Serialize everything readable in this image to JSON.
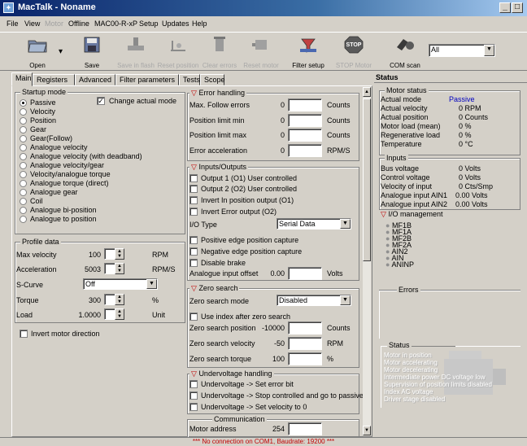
{
  "window": {
    "title": "MacTalk - Noname",
    "minimize": "_",
    "maximize": "□"
  },
  "menu": [
    {
      "label": "File",
      "enabled": true
    },
    {
      "label": "View",
      "enabled": true
    },
    {
      "label": "Motor",
      "enabled": false
    },
    {
      "label": "Offline",
      "enabled": true
    },
    {
      "label": "MAC00-R-xP",
      "enabled": true
    },
    {
      "label": "Setup",
      "enabled": true
    },
    {
      "label": "Updates",
      "enabled": true
    },
    {
      "label": "Help",
      "enabled": true
    }
  ],
  "toolbar": {
    "open": "Open",
    "save": "Save",
    "save_flash": "Save in flash",
    "reset_position": "Reset position",
    "clear_errors": "Clear errors",
    "reset_motor": "Reset motor",
    "filter_setup": "Filter setup",
    "stop_motor": "STOP Motor",
    "stop_sign": "STOP",
    "com_scan": "COM scan",
    "port_value": "All"
  },
  "tabs": [
    "Main",
    "Registers",
    "Advanced",
    "Filter parameters",
    "Tests",
    "Scope"
  ],
  "startup_mode": {
    "title": "Startup mode",
    "change_actual_mode": "Change actual mode",
    "options": [
      "Passive",
      "Velocity",
      "Position",
      "Gear",
      "Gear(Follow)",
      "Analogue velocity",
      "Analogue velocity (with deadband)",
      "Analogue velocity/gear",
      "Velocity/analogue torque",
      "Analogue torque (direct)",
      "Analogue gear",
      "Coil",
      "Analogue bi-position",
      "Analogue to position"
    ],
    "selected": "Passive"
  },
  "profile_data": {
    "title": "Profile data",
    "rows": [
      {
        "label": "Max velocity",
        "value": "100",
        "unit": "RPM"
      },
      {
        "label": "Acceleration",
        "value": "5003",
        "unit": "RPM/S"
      },
      {
        "label": "S-Curve",
        "value": "Off",
        "unit": ""
      },
      {
        "label": "Torque",
        "value": "300",
        "unit": "%"
      },
      {
        "label": "Load",
        "value": "1.0000",
        "unit": "Unit"
      }
    ],
    "invert_direction": "Invert motor direction"
  },
  "error_handling": {
    "title": "Error handling",
    "rows": [
      {
        "label": "Max. Follow errors",
        "value": "0",
        "unit": "Counts"
      },
      {
        "label": "Position limit min",
        "value": "0",
        "unit": "Counts"
      },
      {
        "label": "Position limit max",
        "value": "0",
        "unit": "Counts"
      },
      {
        "label": "Error acceleration",
        "value": "0",
        "unit": "RPM/S"
      }
    ]
  },
  "inputs_outputs": {
    "title": "Inputs/Outputs",
    "checks": [
      "Output 1 (O1) User controlled",
      "Output 2 (O2) User controlled",
      "Invert In position output (O1)",
      "Invert Error output (O2)"
    ],
    "io_type_label": "I/O Type",
    "io_type_value": "Serial Data",
    "checks2": [
      "Positive edge position capture",
      "Negative edge position capture",
      "Disable brake"
    ],
    "analogue_offset_label": "Analogue input offset",
    "analogue_offset_value": "0.00",
    "analogue_offset_unit": "Volts"
  },
  "zero_search": {
    "title": "Zero search",
    "mode_label": "Zero search mode",
    "mode_value": "Disabled",
    "use_index": "Use index after zero search",
    "rows": [
      {
        "label": "Zero search position",
        "value": "-10000",
        "unit": "Counts"
      },
      {
        "label": "Zero search velocity",
        "value": "-50",
        "unit": "RPM"
      },
      {
        "label": "Zero search torque",
        "value": "100",
        "unit": "%"
      }
    ]
  },
  "undervoltage": {
    "title": "Undervoltage handling",
    "checks": [
      "Undervoltage -> Set error bit",
      "Undervoltage -> Stop controlled and go to passive",
      "Undervoltage -> Set velocity to 0"
    ]
  },
  "communication": {
    "title": "Communication",
    "motor_address_label": "Motor address",
    "motor_address_value": "254"
  },
  "status": {
    "title": "Status",
    "motor_status_title": "Motor status",
    "motor_rows": [
      {
        "label": "Actual mode",
        "value": "Passive"
      },
      {
        "label": "Actual velocity",
        "value": "0 RPM"
      },
      {
        "label": "Actual position",
        "value": "0 Counts"
      },
      {
        "label": "Motor load (mean)",
        "value": "0 %"
      },
      {
        "label": "Regenerative load",
        "value": "0 %"
      },
      {
        "label": "Temperature",
        "value": "0 °C"
      }
    ],
    "inputs_title": "Inputs",
    "input_rows": [
      {
        "label": "Bus voltage",
        "value": "0 Volts"
      },
      {
        "label": "Control voltage",
        "value": "0 Volts"
      },
      {
        "label": "Velocity of input",
        "value": "0 Cts/Smp"
      },
      {
        "label": "Analogue input AIN1",
        "value": "0.00 Volts"
      },
      {
        "label": "Analogue input AIN2",
        "value": "0.00 Volts"
      }
    ],
    "io_management_title": "I/O management",
    "io_items": [
      "MF1B",
      "MF1A",
      "MF2B",
      "MF2A",
      "AIN2",
      "AIN",
      "ANINP"
    ],
    "errors_title": "Errors",
    "status_title": "Status",
    "status_items": [
      "Motor in position",
      "Motor accelerating",
      "Motor decelerating",
      "Intermediate power DC voltage low",
      "Supervision of position limits disabled",
      "Index AC voltage",
      "Driver stage disabled"
    ]
  },
  "statusbar": {
    "message": "*** No connection on COM1, Baudrate: 19200 ***"
  }
}
